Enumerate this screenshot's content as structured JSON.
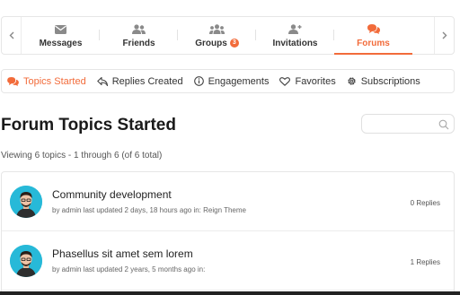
{
  "topnav": {
    "items": [
      {
        "label": "Messages",
        "icon": "envelope-icon"
      },
      {
        "label": "Friends",
        "icon": "users-icon"
      },
      {
        "label": "Groups",
        "icon": "group-icon",
        "badge": "3"
      },
      {
        "label": "Invitations",
        "icon": "user-plus-icon"
      },
      {
        "label": "Forums",
        "icon": "comments-icon",
        "active": true
      }
    ],
    "prev_icon": "chevron-left-icon",
    "next_icon": "chevron-right-icon"
  },
  "subnav": {
    "items": [
      {
        "label": "Topics Started",
        "icon": "comments-icon",
        "active": true
      },
      {
        "label": "Replies Created",
        "icon": "reply-icon"
      },
      {
        "label": "Engagements",
        "icon": "info-icon"
      },
      {
        "label": "Favorites",
        "icon": "heart-icon"
      },
      {
        "label": "Subscriptions",
        "icon": "gear-icon"
      }
    ]
  },
  "page": {
    "title": "Forum Topics Started",
    "viewing": "Viewing 6 topics - 1 through 6 (of 6 total)"
  },
  "search": {
    "placeholder": ""
  },
  "topics": [
    {
      "title": "Community development",
      "meta": "by admin last updated 2 days, 18 hours ago in: Reign Theme",
      "replies": "0 Replies"
    },
    {
      "title": "Phasellus sit amet sem lorem",
      "meta": "by admin last updated 2 years, 5 months ago in:",
      "replies": "1 Replies"
    }
  ],
  "colors": {
    "accent": "#f26b3a",
    "avatar_bg": "#27b9d8"
  }
}
